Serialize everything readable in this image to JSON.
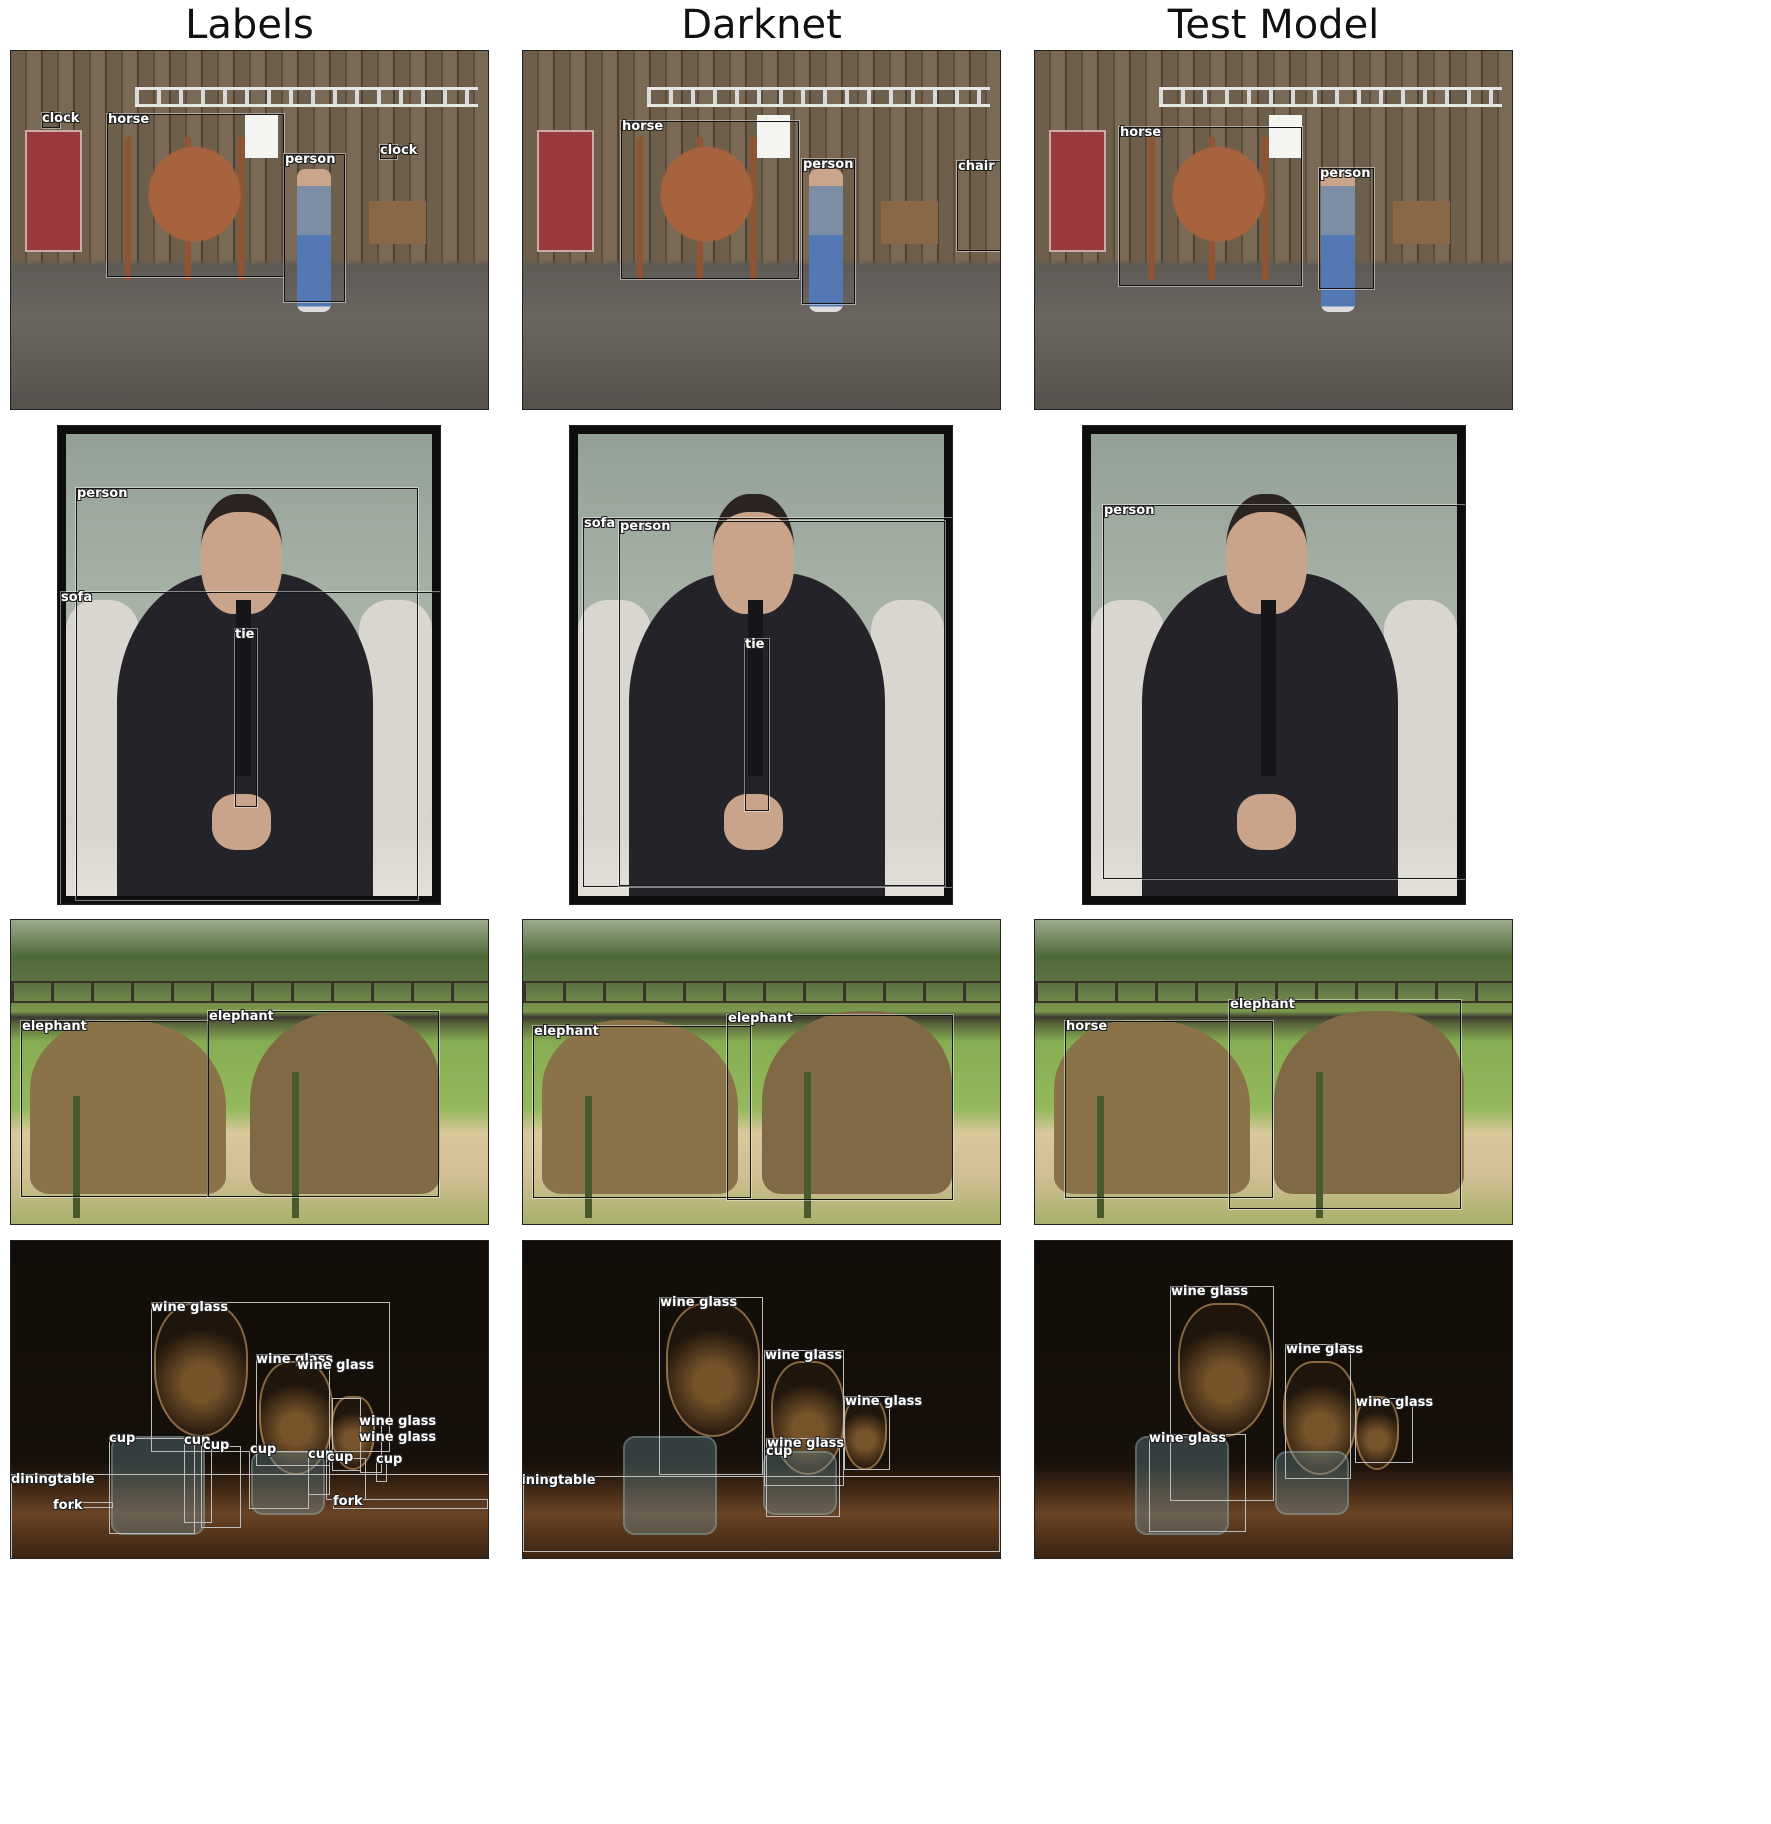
{
  "columns": [
    "Labels",
    "Darknet",
    "Test Model"
  ],
  "scene_names": [
    "barn-horse-scene",
    "man-sofa-scene",
    "elephants-scene",
    "wine-glasses-scene"
  ],
  "labels": {
    "clock": "clock",
    "horse": "horse",
    "person": "person",
    "chair": "chair",
    "sofa": "sofa",
    "tie": "tie",
    "elephant": "elephant",
    "wine_glass": "wine glass",
    "cup": "cup",
    "diningtable": "diningtable",
    "fork": "fork"
  }
}
